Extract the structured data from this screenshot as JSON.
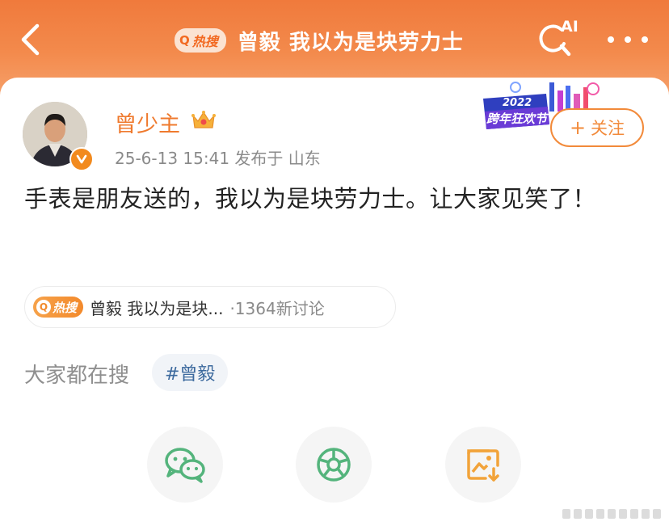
{
  "header": {
    "back_icon": "chevron-left-icon",
    "hot_badge_label": "热搜",
    "title": "曾毅 我以为是块劳力士",
    "ai_search_label": "AI",
    "more_icon": "more-dots-icon"
  },
  "post": {
    "username": "曾少主",
    "crown_icon": "crown-icon",
    "verified_icon": "verified-badge-icon",
    "meta": "25-6-13 15:41  发布于 山东",
    "follow_label": "关注",
    "follow_plus": "+",
    "text": "手表是朋友送的，我以为是块劳力士。让大家见笑了！",
    "promo": {
      "year": "2022",
      "label": "跨年狂欢节"
    }
  },
  "topic": {
    "badge": "热搜",
    "name": "曾毅 我以为是块...",
    "count": "·1364新讨论"
  },
  "search": {
    "label": "大家都在搜",
    "tag": "#曾毅"
  },
  "share": {
    "items": [
      {
        "icon": "wechat-icon",
        "color": "#54b47c"
      },
      {
        "icon": "moments-icon",
        "color": "#54b47c"
      },
      {
        "icon": "save-image-icon",
        "color": "#f2a33a"
      }
    ]
  },
  "colors": {
    "accent": "#f28a3a",
    "brand_orange": "#f07a3c",
    "link_blue": "#3d6a9e"
  }
}
